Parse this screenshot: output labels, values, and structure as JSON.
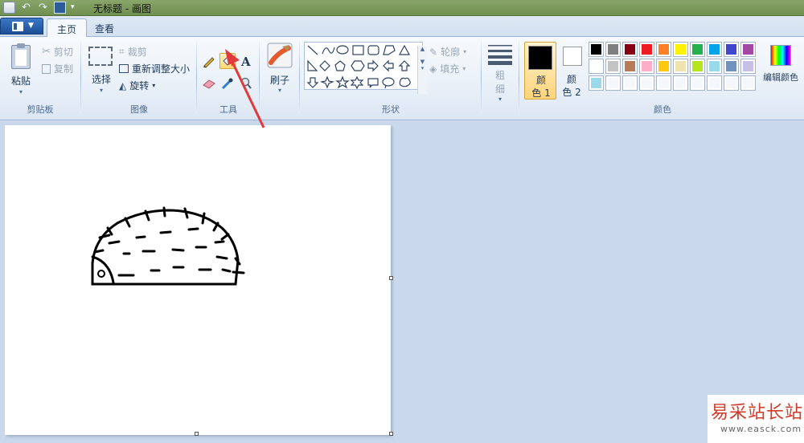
{
  "window": {
    "title": "无标题 - 画图"
  },
  "tabs": [
    {
      "label": "主页"
    },
    {
      "label": "查看"
    }
  ],
  "clipboard": {
    "paste": "粘贴",
    "cut": "剪切",
    "copy": "复制",
    "group": "剪贴板"
  },
  "image": {
    "select": "选择",
    "crop": "裁剪",
    "resize": "重新调整大小",
    "rotate": "旋转",
    "group": "图像"
  },
  "tools": {
    "group": "工具",
    "items": [
      "pencil-icon",
      "fill-icon",
      "text-icon",
      "eraser-icon",
      "color-picker-icon",
      "magnifier-icon"
    ]
  },
  "brushes": {
    "label": "刷子"
  },
  "shapes": {
    "outline": "轮廓",
    "fill": "填充",
    "group": "形状"
  },
  "size": {
    "label_top": "粗",
    "label_bottom": "细"
  },
  "colors": {
    "color1_top": "颜",
    "color1_bottom": "色 1",
    "color2_top": "颜",
    "color2_bottom": "色 2",
    "edit": "编辑颜色",
    "group": "颜色",
    "color1_value": "#000000",
    "color2_value": "#ffffff",
    "palette": [
      "#000000",
      "#7f7f7f",
      "#880015",
      "#ed1c24",
      "#ff7f27",
      "#fff200",
      "#22b14c",
      "#00a2e8",
      "#3f48cc",
      "#a349a4",
      "#ffffff",
      "#c3c3c3",
      "#b97a57",
      "#ffaec9",
      "#ffc90e",
      "#efe4b0",
      "#b5e61d",
      "#99d9ea",
      "#7092be",
      "#c8bfe7",
      "#99d9ea",
      "#ffffff",
      "#ffffff",
      "#ffffff",
      "#ffffff",
      "#ffffff",
      "#ffffff",
      "#ffffff",
      "#ffffff",
      "#ffffff"
    ]
  },
  "watermark": {
    "cn": "易采站长站",
    "en": "www.easck.com"
  }
}
